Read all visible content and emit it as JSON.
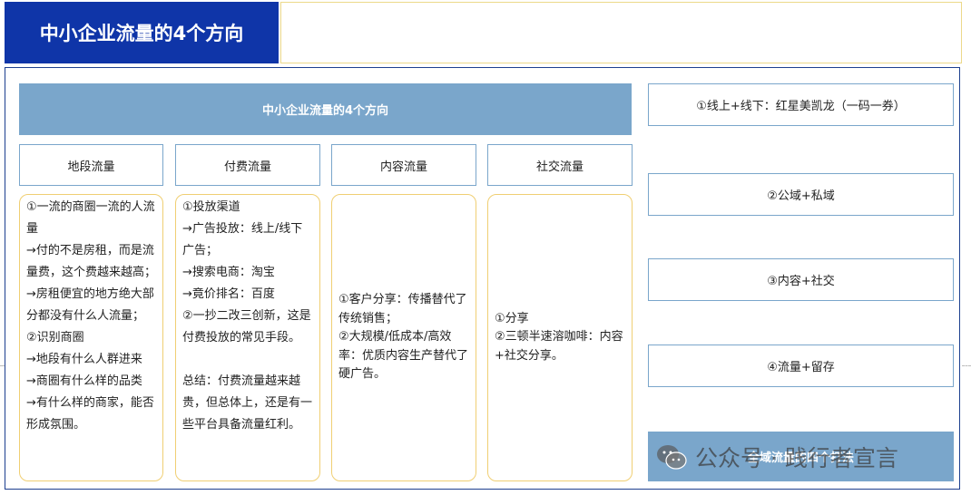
{
  "header": {
    "title": "中小企业流量的4个方向"
  },
  "banner": {
    "label": "中小企业流量的4个方向"
  },
  "columns": [
    {
      "title": "地段流量",
      "lines": [
        "①一流的商圈一流的人流量",
        "→付的不是房租，而是流量费，这个费越来越高；",
        "→房租便宜的地方绝大部分都没有什么人流量；",
        "②识别商圈",
        "→地段有什么人群进来",
        "→商圈有什么样的品类",
        "→有什么样的商家，能否形成氛围。"
      ]
    },
    {
      "title": "付费流量",
      "lines": [
        "①投放渠道",
        "→广告投放：线上/线下广告；",
        "→搜索电商：淘宝",
        "→竟价排名：百度",
        "②一抄二改三创新，这是付费投放的常见手段。",
        "",
        "总结：付费流量越来越贵，但总体上，还是有一些平台具备流量红利。"
      ]
    },
    {
      "title": "内容流量",
      "lines": [
        "①客户分享：传播替代了传统销售；",
        "②大规模/低成本/高效率：优质内容生产替代了硬广告。"
      ]
    },
    {
      "title": "社交流量",
      "lines": [
        "①分享",
        "②三顿半速溶咖啡：内容+社交分享。"
      ]
    }
  ],
  "right_boxes": [
    "①线上+线下：红星美凯龙（一码一券）",
    "②公域+私域",
    "③内容+社交",
    "④流量+留存"
  ],
  "right_bottom": {
    "label": "全域流量的四个打法"
  },
  "watermark": {
    "text": "公众号 · 践行者宣言",
    "icon": "wechat-icon"
  }
}
